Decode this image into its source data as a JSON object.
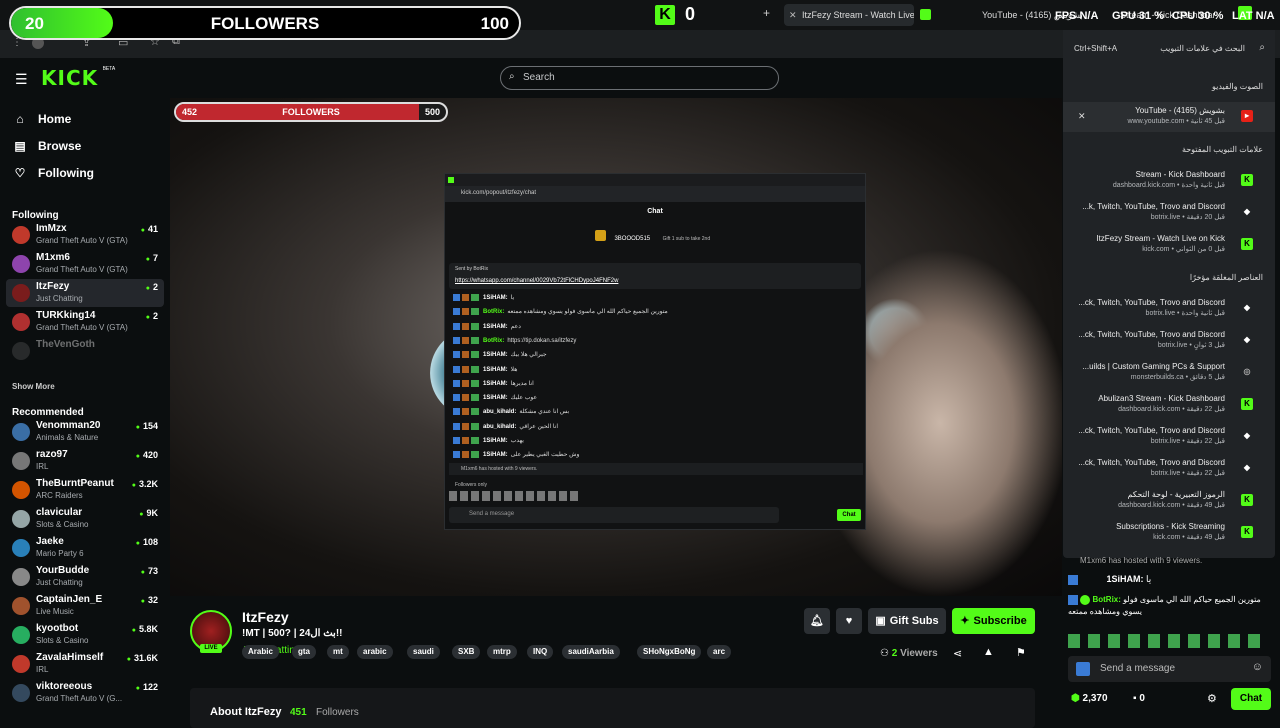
{
  "browser": {
    "tabs": [
      {
        "label": "ItzFezy Stream - Watch Live on"
      },
      {
        "label": "YouTube - بشويش (4165)"
      },
      {
        "label": "Stream - Kick Dashboard"
      }
    ],
    "stats": {
      "fps": "FPS N/A",
      "gpu": "GPU 31 %",
      "cpu": "CPU 30 %",
      "lat": "LAT N/A"
    },
    "kick_count": "0"
  },
  "follower_goal": {
    "current": "20",
    "label": "FOLLOWERS",
    "target": "100",
    "fraction": 0.2
  },
  "inner_goal": {
    "current": "452",
    "label": "FOLLOWERS",
    "target": "500",
    "fraction": 0.9
  },
  "header": {
    "logo": "KICK",
    "logo_badge": "BETA",
    "search_placeholder": "Search"
  },
  "nav": [
    {
      "label": "Home"
    },
    {
      "label": "Browse"
    },
    {
      "label": "Following"
    }
  ],
  "following_title": "Following",
  "following": [
    {
      "name": "ImMzx",
      "category": "Grand Theft Auto V (GTA)",
      "viewers": "41",
      "color": "#c0392b"
    },
    {
      "name": "M1xm6",
      "category": "Grand Theft Auto V (GTA)",
      "viewers": "7",
      "color": "#8e44ad"
    },
    {
      "name": "ItzFezy",
      "category": "Just Chatting",
      "viewers": "2",
      "color": "#7a1c1c"
    },
    {
      "name": "TURKking14",
      "category": "Grand Theft Auto V (GTA)",
      "viewers": "2",
      "color": "#b03030"
    },
    {
      "name": "TheVenGoth",
      "category": "",
      "viewers": "",
      "color": "#555"
    }
  ],
  "show_more": "Show More",
  "recommended_title": "Recommended",
  "recommended": [
    {
      "name": "Venomman20",
      "category": "Animals & Nature",
      "viewers": "154",
      "color": "#3a6ea5"
    },
    {
      "name": "razo97",
      "category": "IRL",
      "viewers": "420",
      "color": "#777"
    },
    {
      "name": "TheBurntPeanut",
      "category": "ARC Raiders",
      "viewers": "3.2K",
      "color": "#d35400"
    },
    {
      "name": "clavicular",
      "category": "Slots & Casino",
      "viewers": "9K",
      "color": "#95a5a6"
    },
    {
      "name": "Jaeke",
      "category": "Mario Party 6",
      "viewers": "108",
      "color": "#2980b9"
    },
    {
      "name": "YourBudde",
      "category": "Just Chatting",
      "viewers": "73",
      "color": "#888"
    },
    {
      "name": "CaptainJen_E",
      "category": "Live Music",
      "viewers": "32",
      "color": "#a0522d"
    },
    {
      "name": "kyootbot",
      "category": "Slots & Casino",
      "viewers": "5.8K",
      "color": "#27ae60"
    },
    {
      "name": "ZavalaHimself",
      "category": "IRL",
      "viewers": "31.6K",
      "color": "#c0392b"
    },
    {
      "name": "viktoreeous",
      "category": "Grand Theft Auto V (G...",
      "viewers": "122",
      "color": "#34495e"
    }
  ],
  "popout": {
    "url": "kick.com/popout/itzfezy/chat",
    "title": "Chat",
    "top_gifter": "3BOOOD515",
    "gift_text": "Gift 1 sub to take 2nd",
    "pinned_sender": "Sent by BotRix",
    "pinned_link": "https://whatsapp.com/channel/0029Vb72tFlCHDypoJ4FNF2w",
    "lines": [
      {
        "user": "1SiHAM:",
        "text": "يا"
      },
      {
        "user": "BotRix:",
        "text": "متورين الجميع حياكم الله الي ماسوى فولو يسوي ومشاهده ممتعه"
      },
      {
        "user": "1SiHAM:",
        "text": "دعم"
      },
      {
        "user": "BotRix:",
        "text": "https://tip.dokan.sa/itzfezy"
      },
      {
        "user": "1SiHAM:",
        "text": "جيرالي هلا بيك"
      },
      {
        "user": "1SiHAM:",
        "text": "هلا"
      },
      {
        "user": "1SiHAM:",
        "text": "انا مديرها"
      },
      {
        "user": "1SiHAM:",
        "text": "عوب عليك"
      },
      {
        "user": "abu_kihald:",
        "text": "بس انا عندي مشكلة"
      },
      {
        "user": "abu_kihald:",
        "text": "انا الحين عراقي"
      },
      {
        "user": "1SiHAM:",
        "text": "يهدب"
      },
      {
        "user": "1SiHAM:",
        "text": "وش حطيت الغبي يطير على"
      }
    ],
    "hosted": "M1xm6 has hosted with 9 viewers.",
    "followers_only": "Followers only",
    "send_placeholder": "Send a message",
    "chat_btn": "Chat"
  },
  "bookmarks": {
    "search_label": "البحث في علامات التبويب",
    "shortcut": "Ctrl+Shift+A",
    "audio_video_title": "الصوت والفيديو",
    "audio_item": {
      "title": "YouTube - بشويش (4165)",
      "sub": "www.youtube.com • قبل 45 ثانية"
    },
    "open_tabs_title": "علامات التبويب المفتوحة",
    "open_tabs": [
      {
        "title": "Stream - Kick Dashboard",
        "sub": "dashboard.kick.com • قبل ثانية واحدة",
        "icon": "K",
        "color": "#53fc18"
      },
      {
        "title": "...k, Twitch, YouTube, Trovo and Discord",
        "sub": "botrix.live • قبل 20 دقيقة",
        "icon": "◆",
        "color": "#fff"
      },
      {
        "title": "ItzFezy Stream - Watch Live on Kick",
        "sub": "kick.com • قبل 0 من الثواني",
        "icon": "K",
        "color": "#53fc18"
      }
    ],
    "closed_title": "العناصر المغلقة مؤخرًا",
    "closed": [
      {
        "title": "...ck, Twitch, YouTube, Trovo and Discord",
        "sub": "botrix.live • قبل ثانية واحدة",
        "icon": "◆",
        "color": "#fff"
      },
      {
        "title": "...ck, Twitch, YouTube, Trovo and Discord",
        "sub": "botrix.live • قبل 3 ثوانٍ",
        "icon": "◆",
        "color": "#fff"
      },
      {
        "title": "...uilds | Custom Gaming PCs & Support",
        "sub": "monsterbuilds.ca • قبل 5 دقائق",
        "icon": "◎",
        "color": "#aaa"
      },
      {
        "title": "Abulizan3 Stream - Kick Dashboard",
        "sub": "dashboard.kick.com • قبل 22 دقيقة",
        "icon": "K",
        "color": "#53fc18"
      },
      {
        "title": "...ck, Twitch, YouTube, Trovo and Discord",
        "sub": "botrix.live • قبل 22 دقيقة",
        "icon": "◆",
        "color": "#fff"
      },
      {
        "title": "...ck, Twitch, YouTube, Trovo and Discord",
        "sub": "botrix.live • قبل 22 دقيقة",
        "icon": "◆",
        "color": "#fff"
      },
      {
        "title": "الرموز التعبيرية - لوحة التحكم",
        "sub": "dashboard.kick.com • قبل 49 دقيقة",
        "icon": "K",
        "color": "#53fc18"
      },
      {
        "title": "Subscriptions - Kick Streaming",
        "sub": "kick.com • قبل 49 دقيقة",
        "icon": "K",
        "color": "#53fc18"
      }
    ]
  },
  "stream": {
    "name": "ItzFezy",
    "title": "!MT | 500? | بث ال24!!",
    "category": "Just Chatting",
    "tags": [
      "Arabic",
      "gta",
      "mt",
      "arabic",
      "saudi",
      "SXB",
      "mtrp",
      "INQ",
      "saudiAarbia",
      "SHoNgxBoNg",
      "arc"
    ],
    "live": "LIVE",
    "gift_subs": "Gift Subs",
    "subscribe": "Subscribe",
    "viewers_count": "2",
    "viewers_label": "Viewers",
    "about_label": "About ItzFezy",
    "about_followers": "451",
    "about_followers_label": "Followers"
  },
  "right_chat": {
    "hosted_text": "M1xm6 has hosted with 9 viewers.",
    "line1_user": "1SiHAM:",
    "line1_text": "يا",
    "line2_user": "BotRix:",
    "line2_text": "متورين الجميع حياكم الله الي ماسوى فولو يسوي ومشاهده ممتعه",
    "send_placeholder": "Send a message",
    "points": "2,370",
    "zero": "0",
    "chat_btn": "Chat"
  },
  "colors": {
    "accent": "#53fc18",
    "bg": "#0b0e0f",
    "panel": "#202326"
  }
}
